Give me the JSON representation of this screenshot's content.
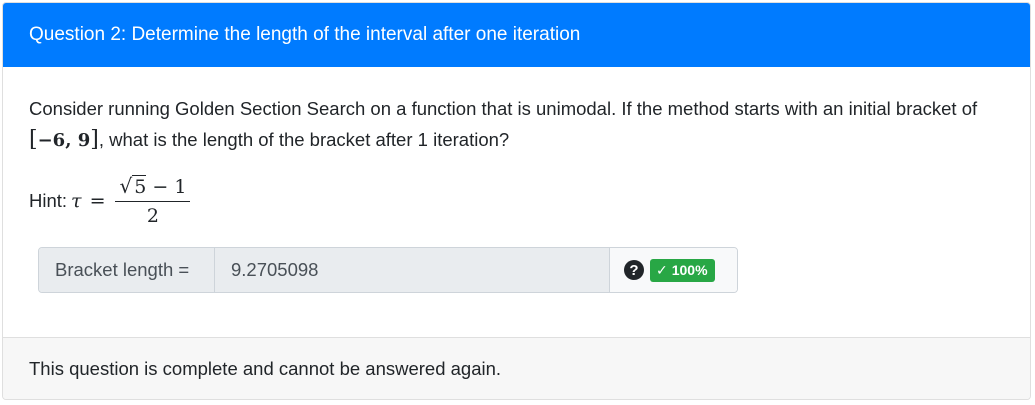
{
  "header": {
    "title": "Question 2: Determine the length of the interval after one iteration"
  },
  "question": {
    "prompt_part1": "Consider running Golden Section Search on a function that is unimodal. If the method starts with an initial bracket of ",
    "interval_open": "[",
    "interval_value": "−6, 9",
    "interval_close": "]",
    "prompt_part2": ", what is the length of the bracket after 1 iteration?",
    "hint_label": "Hint:",
    "hint_symbol": "τ",
    "hint_equals": "=",
    "hint_sqrt": "√",
    "hint_sqrt_arg": "5",
    "hint_numerator_rest": " − 1",
    "hint_denominator": "2"
  },
  "answer": {
    "label": "Bracket length =",
    "value": "9.2705098",
    "help_icon": "question-circle-icon",
    "help_glyph": "?",
    "score_check": "✓",
    "score_text": "100%",
    "score_color": "#28a745"
  },
  "footer": {
    "message": "This question is complete and cannot be answered again."
  },
  "colors": {
    "header_bg": "#007bff",
    "input_bg": "#e9ecef",
    "footer_bg": "#f7f7f7"
  }
}
